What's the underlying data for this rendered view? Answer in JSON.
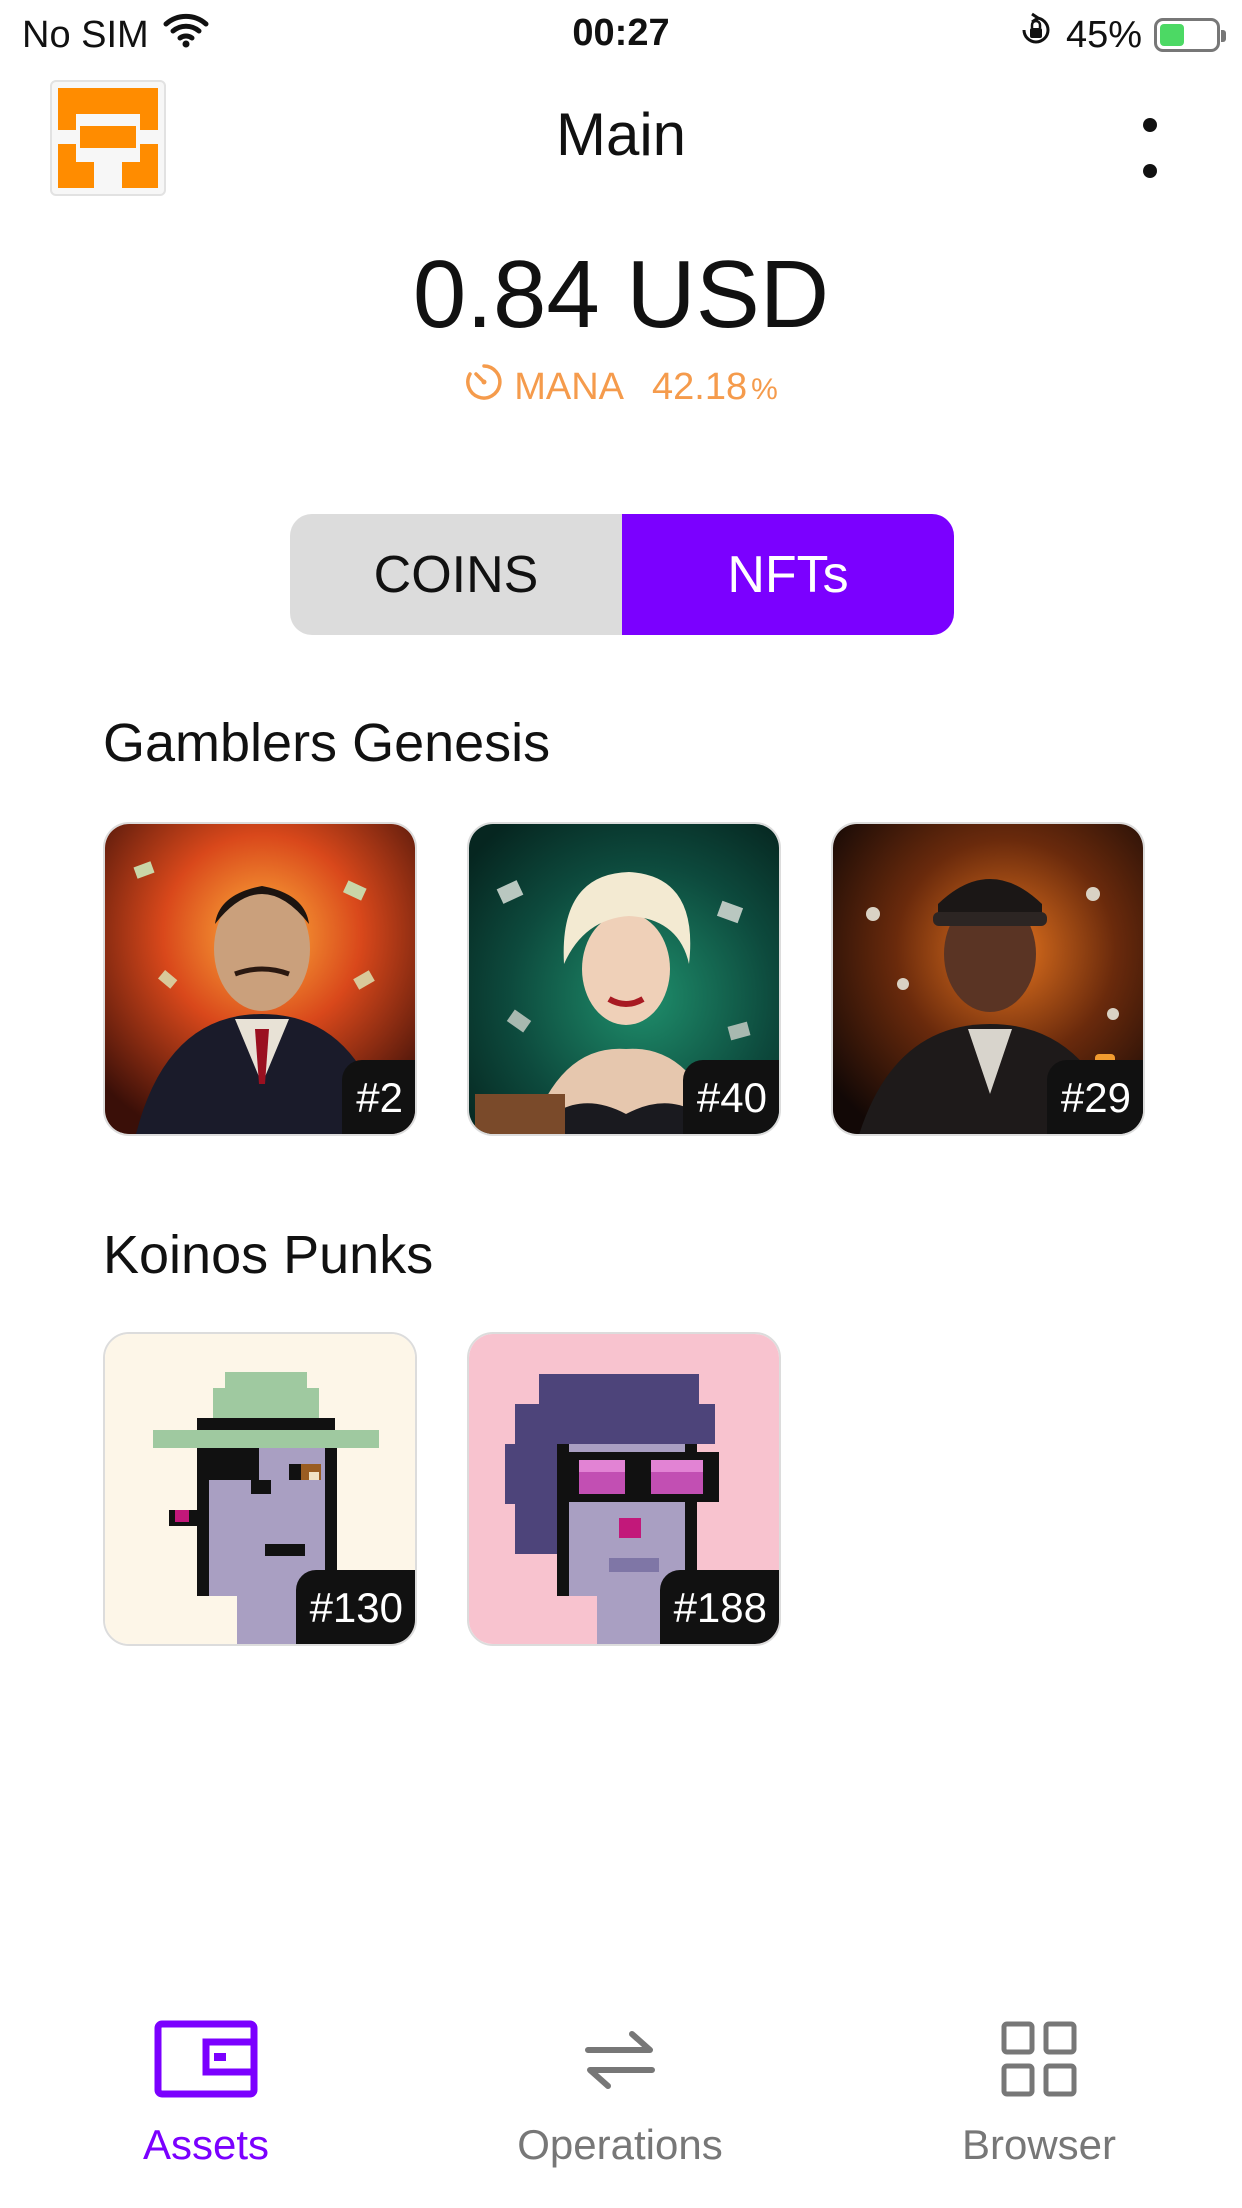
{
  "status_bar": {
    "carrier": "No SIM",
    "time": "00:27",
    "battery": "45%",
    "battery_level": 0.45
  },
  "header": {
    "title": "Main"
  },
  "balance": {
    "amount": "0.84 USD",
    "token": "MANA",
    "change": "42.18",
    "change_unit": "%"
  },
  "tabs": {
    "coins": "COINS",
    "nfts": "NFTs",
    "active": "NFTs"
  },
  "collections": [
    {
      "name": "Gamblers Genesis",
      "items": [
        {
          "id": "#2"
        },
        {
          "id": "#40"
        },
        {
          "id": "#29"
        }
      ]
    },
    {
      "name": "Koinos Punks",
      "items": [
        {
          "id": "#130"
        },
        {
          "id": "#188"
        }
      ]
    }
  ],
  "nav": {
    "items": [
      {
        "label": "Assets",
        "icon": "wallet-icon",
        "active": true
      },
      {
        "label": "Operations",
        "icon": "arrows-exchange-icon",
        "active": false
      },
      {
        "label": "Browser",
        "icon": "grid-icon",
        "active": false
      }
    ]
  },
  "colors": {
    "accent": "#7b00ff",
    "mana": "#f59b4c",
    "logo": "#ff8c00"
  }
}
